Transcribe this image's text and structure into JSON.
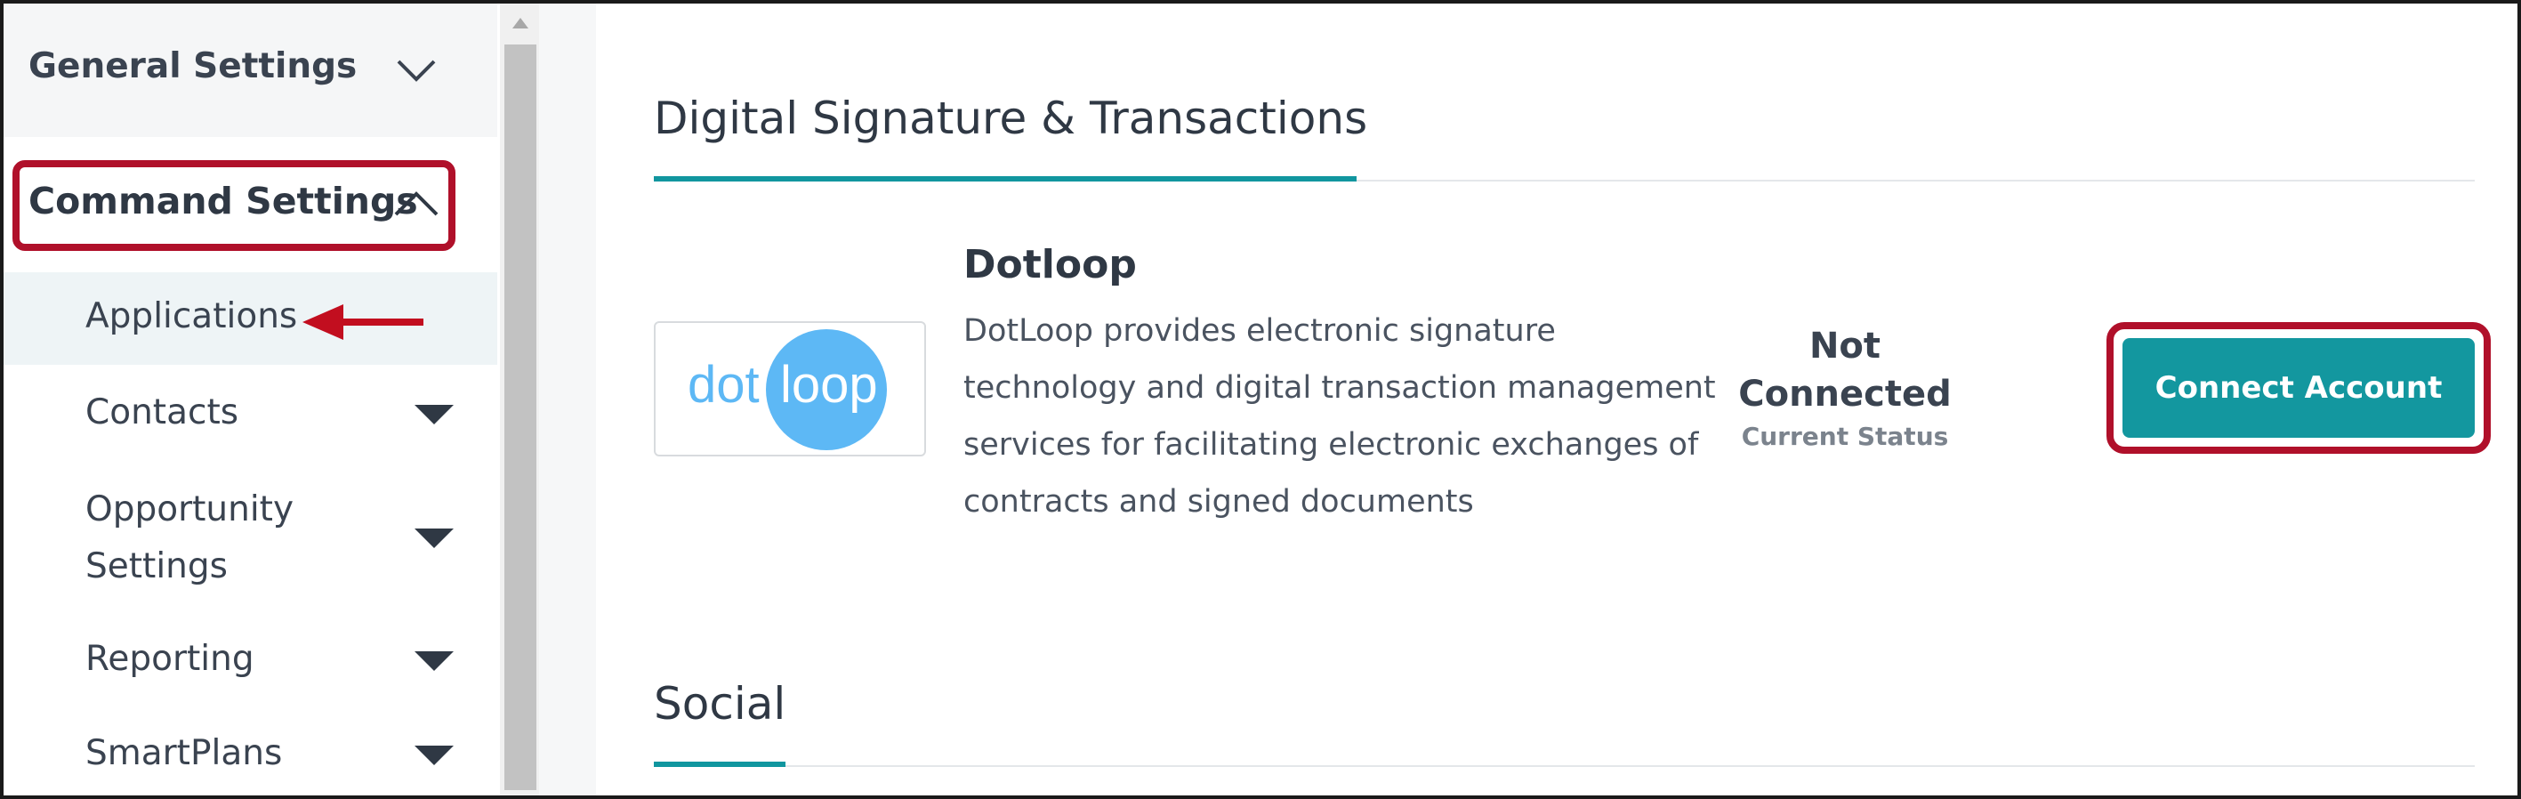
{
  "sidebar": {
    "general_settings_label": "General Settings",
    "command_settings_label": "Command Settings",
    "items": [
      {
        "label": "Applications"
      },
      {
        "label": "Contacts"
      },
      {
        "label_line1": "Opportunity",
        "label_line2": "Settings"
      },
      {
        "label": "Reporting"
      },
      {
        "label": "SmartPlans"
      }
    ]
  },
  "main": {
    "sections": [
      {
        "title": "Digital Signature & Transactions"
      },
      {
        "title": "Social"
      }
    ],
    "app": {
      "logo_text_left": "dot",
      "logo_text_right": "loop",
      "name": "Dotloop",
      "description": "DotLoop provides electronic signature technology and digital transaction management services for facilitating electronic exchanges of contracts and signed documents",
      "status_line1": "Not",
      "status_line2": "Connected",
      "status_caption": "Current Status",
      "button_label": "Connect Account"
    }
  },
  "colors": {
    "accent_teal": "#13979f",
    "highlight_red": "#b0102a",
    "logo_blue": "#5db8f5"
  },
  "icons": [
    "chevron-down-icon",
    "chevron-up-icon",
    "caret-down-icon",
    "red-arrow-icon",
    "scroll-up-arrow-icon"
  ]
}
